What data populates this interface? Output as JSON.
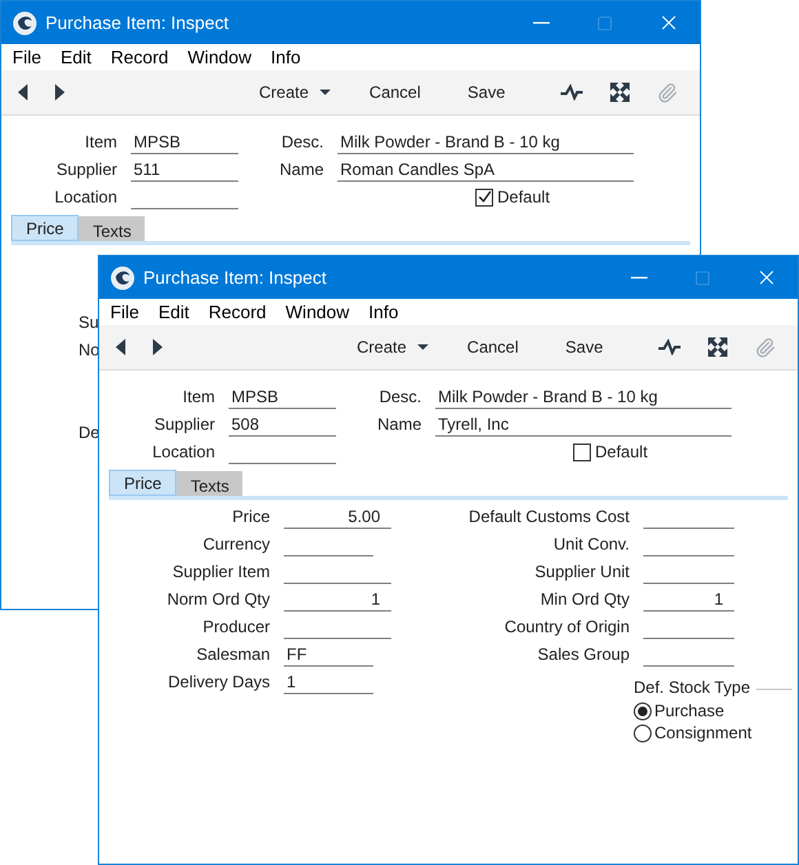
{
  "windows": [
    {
      "title": "Purchase Item: Inspect",
      "menu": [
        "File",
        "Edit",
        "Record",
        "Window",
        "Info"
      ],
      "toolbar": [
        {
          "label": "Create",
          "dropdown": true
        },
        {
          "label": "Cancel",
          "dropdown": false
        },
        {
          "label": "Save",
          "dropdown": false
        }
      ],
      "header_left": [
        {
          "label": "Item",
          "value": "MPSB"
        },
        {
          "label": "Supplier",
          "value": "511"
        },
        {
          "label": "Location"
        }
      ],
      "header_right": [
        {
          "label": "Desc.",
          "value": "Milk Powder - Brand B - 10 kg"
        },
        {
          "label": "Name",
          "value": "Roman Candles SpA"
        }
      ],
      "default_checkbox": {
        "label": "Default",
        "checked": true
      },
      "tabs": [
        {
          "label": "Price",
          "selected": true
        },
        {
          "label": "Texts",
          "selected": false
        }
      ],
      "clipped_labels": [
        "Su",
        "No",
        "De"
      ]
    },
    {
      "title": "Purchase Item: Inspect",
      "menu": [
        "File",
        "Edit",
        "Record",
        "Window",
        "Info"
      ],
      "toolbar": [
        {
          "label": "Create",
          "dropdown": true
        },
        {
          "label": "Cancel",
          "dropdown": false
        },
        {
          "label": "Save",
          "dropdown": false
        }
      ],
      "header_left": [
        {
          "label": "Item",
          "value": "MPSB"
        },
        {
          "label": "Supplier",
          "value": "508"
        },
        {
          "label": "Location"
        }
      ],
      "header_right": [
        {
          "label": "Desc.",
          "value": "Milk Powder - Brand B - 10 kg"
        },
        {
          "label": "Name",
          "value": "Tyrell, Inc"
        }
      ],
      "default_checkbox": {
        "label": "Default",
        "checked": false
      },
      "tabs": [
        {
          "label": "Price",
          "selected": true
        },
        {
          "label": "Texts",
          "selected": false
        }
      ],
      "price_left": [
        {
          "label": "Price",
          "value": "5.00",
          "kind": "wide"
        },
        {
          "label": "Currency",
          "kind": "short"
        },
        {
          "label": "Supplier Item",
          "kind": "wide"
        },
        {
          "label": "Norm Ord Qty",
          "value": "1",
          "kind": "wide"
        },
        {
          "label": "Producer",
          "kind": "wide"
        },
        {
          "label": "Salesman",
          "value": "FF",
          "kind": "short"
        },
        {
          "label": "Delivery Days",
          "value": "1",
          "kind": "short"
        }
      ],
      "price_right": [
        {
          "label": "Default Customs Cost"
        },
        {
          "label": "Unit Conv."
        },
        {
          "label": "Supplier Unit"
        },
        {
          "label": "Min Ord Qty",
          "value": "1"
        },
        {
          "label": "Country of Origin"
        },
        {
          "label": "Sales Group"
        }
      ],
      "stock_type": {
        "label": "Def. Stock Type",
        "options": [
          {
            "label": "Purchase",
            "selected": true
          },
          {
            "label": "Consignment",
            "selected": false
          }
        ]
      }
    }
  ]
}
